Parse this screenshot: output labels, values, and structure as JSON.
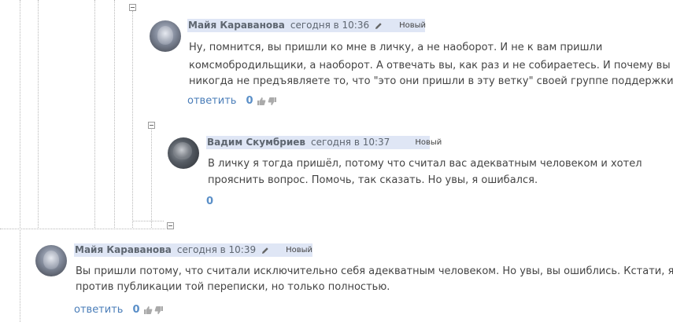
{
  "comments": [
    {
      "author": "Майя Караванова",
      "time": "сегодня в 10:36",
      "badge": "Новый",
      "lines": [
        "Ну, помнится, вы пришли ко мне в личку, а не наоборот. И не к вам пришли",
        "комсмобродильщики, а наоборот. А отвечать вы, как раз и не собираетесь. И почему вы",
        "никогда не предъявляете то, что \"это они пришли в эту ветку\" своей группе поддержки?"
      ],
      "reply_label": "ответить",
      "score": "0"
    },
    {
      "author": "Вадим Скумбриев",
      "time": "сегодня в 10:37",
      "badge": "Новый",
      "lines": [
        "В личку я тогда пришёл, потому что считал вас адекватным человеком и хотел",
        "прояснить вопрос. Помочь, так сказать. Но увы, я ошибался."
      ],
      "score": "0"
    },
    {
      "author": "Майя Караванова",
      "time": "сегодня в 10:39",
      "badge": "Новый",
      "lines": [
        "Вы пришли потому, что считали исключительно себя адекватным человеком. Но увы, вы ошиблись. Кстати, я не",
        "против публикации той переписки, но только полностью."
      ],
      "reply_label": "ответить",
      "score": "0"
    }
  ]
}
